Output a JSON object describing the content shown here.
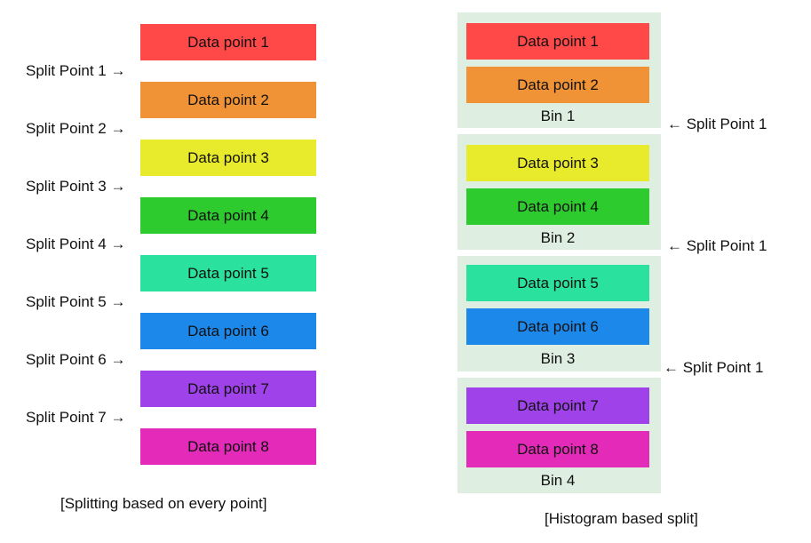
{
  "left": {
    "caption": "[Splitting based on every point]",
    "data_points": [
      {
        "label": "Data point 1",
        "color": "#ff4848"
      },
      {
        "label": "Data point 2",
        "color": "#f09236"
      },
      {
        "label": "Data point 3",
        "color": "#e8ea2c"
      },
      {
        "label": "Data point 4",
        "color": "#2ecb2e"
      },
      {
        "label": "Data point 5",
        "color": "#2ae19e"
      },
      {
        "label": "Data point 6",
        "color": "#1b88ea"
      },
      {
        "label": "Data point 7",
        "color": "#a042ea"
      },
      {
        "label": "Data point 8",
        "color": "#e42ab8"
      }
    ],
    "split_points": [
      "Split Point 1 →",
      "Split Point 2 →",
      "Split Point 3 →",
      "Split Point 4 →",
      "Split Point 5 →",
      "Split Point 6 →",
      "Split Point 7 →"
    ]
  },
  "right": {
    "caption": "[Histogram based split]",
    "bin_color": "#deeee0",
    "bins": [
      {
        "label": "Bin 1",
        "points": [
          {
            "label": "Data point 1",
            "color": "#ff4848"
          },
          {
            "label": "Data point 2",
            "color": "#f09236"
          }
        ]
      },
      {
        "label": "Bin 2",
        "points": [
          {
            "label": "Data point 3",
            "color": "#e8ea2c"
          },
          {
            "label": "Data point 4",
            "color": "#2ecb2e"
          }
        ]
      },
      {
        "label": "Bin 3",
        "points": [
          {
            "label": "Data point 5",
            "color": "#2ae19e"
          },
          {
            "label": "Data point 6",
            "color": "#1b88ea"
          }
        ]
      },
      {
        "label": "Bin 4",
        "points": [
          {
            "label": "Data point 7",
            "color": "#a042ea"
          },
          {
            "label": "Data point 8",
            "color": "#e42ab8"
          }
        ]
      }
    ],
    "split_points": [
      "← Split Point 1",
      "← Split Point 1",
      "← Split Point 1"
    ]
  }
}
